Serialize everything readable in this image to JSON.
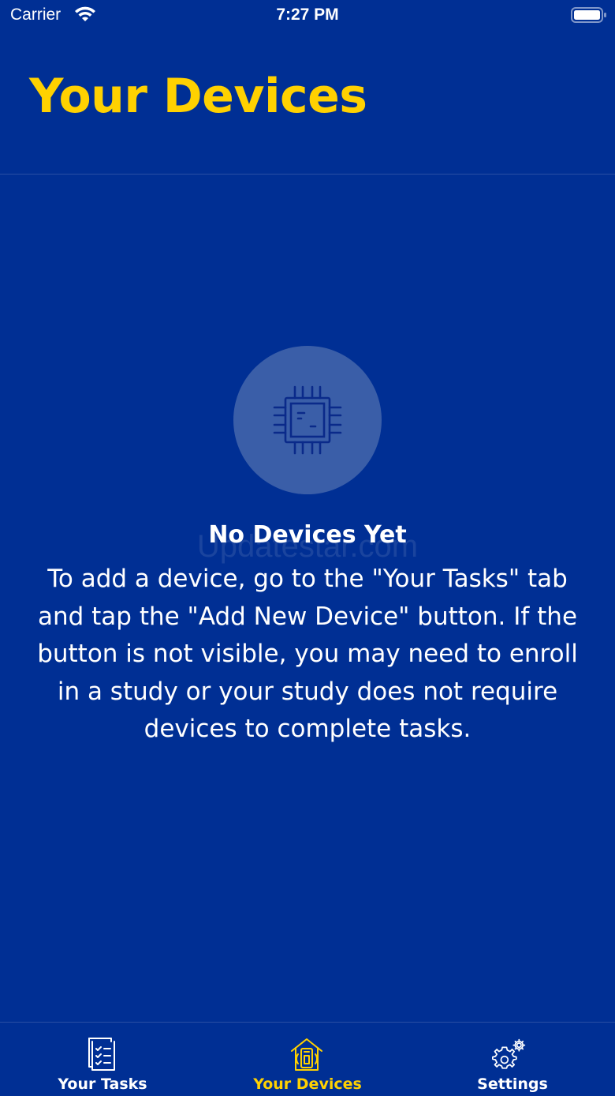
{
  "status_bar": {
    "carrier": "Carrier",
    "time": "7:27 PM"
  },
  "header": {
    "title": "Your Devices"
  },
  "empty_state": {
    "icon": "chip-icon",
    "title": "No Devices Yet",
    "watermark": "Updatestar.com",
    "message": "To add a device, go to the \"Your Tasks\" tab and tap the \"Add New Device\" button. If the button is not visible, you may need to enroll in a study or your study does not require devices to complete tasks."
  },
  "tabs": [
    {
      "label": "Your Tasks",
      "icon": "task-list-icon",
      "active": false
    },
    {
      "label": "Your Devices",
      "icon": "device-home-icon",
      "active": true
    },
    {
      "label": "Settings",
      "icon": "gear-icon",
      "active": false
    }
  ],
  "colors": {
    "background": "#002f94",
    "accent": "#ffd100",
    "circle": "#3a5ea8"
  }
}
